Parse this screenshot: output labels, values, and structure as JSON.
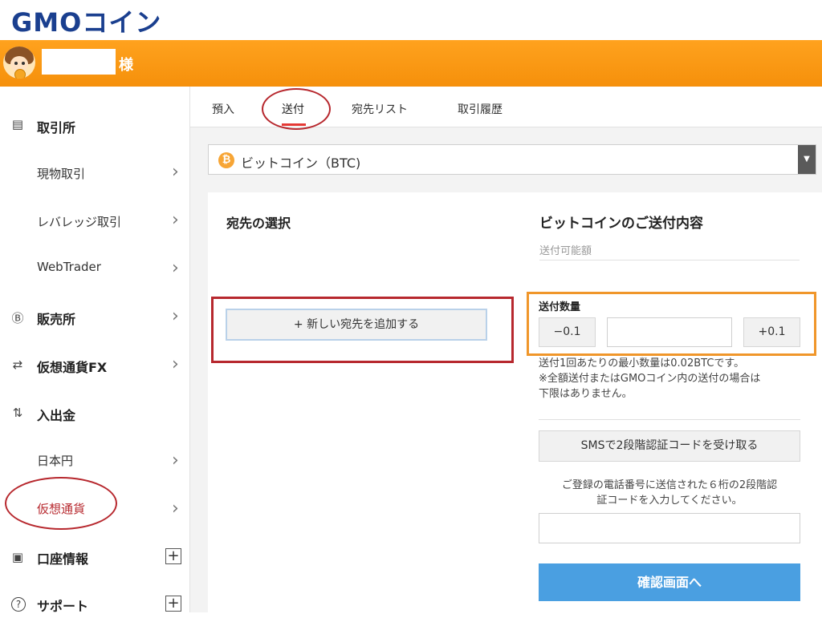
{
  "brand": {
    "logo_text": "GMOコイン"
  },
  "user": {
    "suffix": "様"
  },
  "sidebar": {
    "items": [
      {
        "icon": "building-icon",
        "glyph": "▤",
        "label": "取引所"
      },
      {
        "label": "現物取引"
      },
      {
        "label": "レバレッジ取引"
      },
      {
        "label": "WebTrader"
      },
      {
        "icon": "bitcoin-circle-icon",
        "glyph": "Ⓑ",
        "label": "販売所"
      },
      {
        "icon": "exchange-arrows-icon",
        "glyph": "⇄",
        "label": "仮想通貨FX"
      },
      {
        "icon": "deposit-icon",
        "glyph": "⇅",
        "label": "入出金"
      },
      {
        "label": "日本円"
      },
      {
        "label": "仮想通貨"
      },
      {
        "icon": "account-card-icon",
        "glyph": "▣",
        "label": "口座情報"
      },
      {
        "icon": "help-circle-icon",
        "glyph": "?",
        "label": "サポート"
      }
    ]
  },
  "tabs": [
    {
      "label": "預入"
    },
    {
      "label": "送付",
      "active": true
    },
    {
      "label": "宛先リスト"
    },
    {
      "label": "取引履歴"
    }
  ],
  "coin_select": {
    "symbol": "₿",
    "label": "ビットコイン（BTC)"
  },
  "destination": {
    "title": "宛先の選択",
    "add_button": "+ 新しい宛先を追加する"
  },
  "send": {
    "title": "ビットコインのご送付内容",
    "available_label": "送付可能額",
    "quantity_label": "送付数量",
    "minus_button": "−0.1",
    "plus_button": "+0.1",
    "quantity_value": "",
    "note_lines": [
      "送付1回あたりの最小数量は0.02BTCです。",
      "※全額送付またはGMOコイン内の送付の場合は",
      "下限はありません。"
    ],
    "sms_button": "SMSで2段階認証コードを受け取る",
    "sms_note_lines": [
      "ご登録の電話番号に送信された６桁の2段階認",
      "証コードを入力してください。"
    ],
    "code_value": "",
    "confirm_button": "確認画面へ"
  },
  "colors": {
    "brand_blue": "#1a3f8f",
    "header_orange": "#f5900b",
    "annotation_red": "#b7282e",
    "annotation_orange": "#f0962a",
    "confirm_blue": "#4a9fe1"
  }
}
